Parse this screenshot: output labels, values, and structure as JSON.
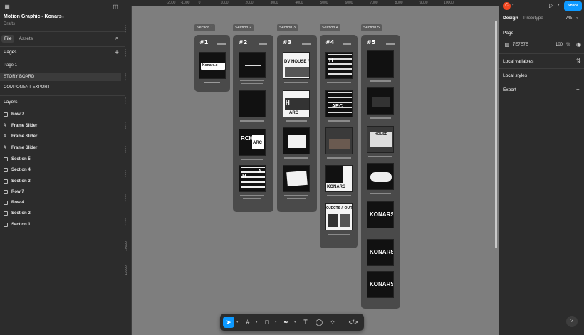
{
  "file": {
    "title": "Motion Graphic - Konars",
    "location": "Drafts"
  },
  "left_tabs": [
    "File",
    "Assets"
  ],
  "pages": {
    "title": "Pages",
    "items": [
      "Page 1",
      "STORY BOARD",
      "COMPONENT EXPORT"
    ],
    "selected": "STORY BOARD"
  },
  "layers": {
    "title": "Layers",
    "items": [
      {
        "icon": "row-icon",
        "label": "Row 7"
      },
      {
        "icon": "frame-icon",
        "label": "Frame Slider"
      },
      {
        "icon": "frame-icon",
        "label": "Frame Slider"
      },
      {
        "icon": "frame-icon",
        "label": "Frame Slider"
      },
      {
        "icon": "section-icon",
        "label": "Section 5"
      },
      {
        "icon": "section-icon",
        "label": "Section 4"
      },
      {
        "icon": "section-icon",
        "label": "Section 3"
      },
      {
        "icon": "row-icon",
        "label": "Row 7"
      },
      {
        "icon": "row-icon",
        "label": "Row 4"
      },
      {
        "icon": "section-icon",
        "label": "Section 2"
      },
      {
        "icon": "section-icon",
        "label": "Section 1"
      }
    ]
  },
  "ruler_top": [
    "-2000",
    "-1000",
    "0",
    "1000",
    "2000",
    "3000",
    "4000",
    "5000",
    "6000",
    "7000",
    "8000",
    "9000",
    "10000"
  ],
  "ruler_left": [
    "1000",
    "2000",
    "3000",
    "4000",
    "5000",
    "6000",
    "7000",
    "8000",
    "9000",
    "10000",
    "11000"
  ],
  "sections": [
    {
      "label": "Section 1",
      "num": "#1",
      "frame_texts": [
        "Konars.c"
      ]
    },
    {
      "label": "Section 2",
      "num": "#2",
      "frame_texts": [
        "RCH",
        "ARC",
        "H",
        "A"
      ]
    },
    {
      "label": "Section 3",
      "num": "#3",
      "frame_texts": [
        "DV HOUSE /",
        "H",
        "ARC"
      ]
    },
    {
      "label": "Section 4",
      "num": "#4",
      "frame_texts": [
        "H",
        "ARC",
        "KONARS",
        "OJECTS // OUR"
      ]
    },
    {
      "label": "Section 5",
      "num": "#5",
      "frame_texts": [
        "HOUSE",
        "KONARS",
        "KONARS",
        "KONARS"
      ]
    }
  ],
  "toolbar": [
    "move-tool",
    "frame-tool",
    "shape-tool",
    "pen-tool",
    "text-tool",
    "comment-tool",
    "actions-tool",
    "dev-mode-tool"
  ],
  "right": {
    "avatar": "C",
    "share": "Share",
    "tabs": [
      "Design",
      "Prototype"
    ],
    "zoom": "7%",
    "page_section": "Page",
    "page_color": "7E7E7E",
    "page_opacity": "100",
    "percent": "%",
    "local_variables": "Local variables",
    "local_styles": "Local styles",
    "export": "Export",
    "help": "?"
  },
  "colors": {
    "canvas": "#7e7e7e",
    "panel": "#2c2c2c",
    "accent": "#0d99ff",
    "avatar": "#f24822"
  }
}
